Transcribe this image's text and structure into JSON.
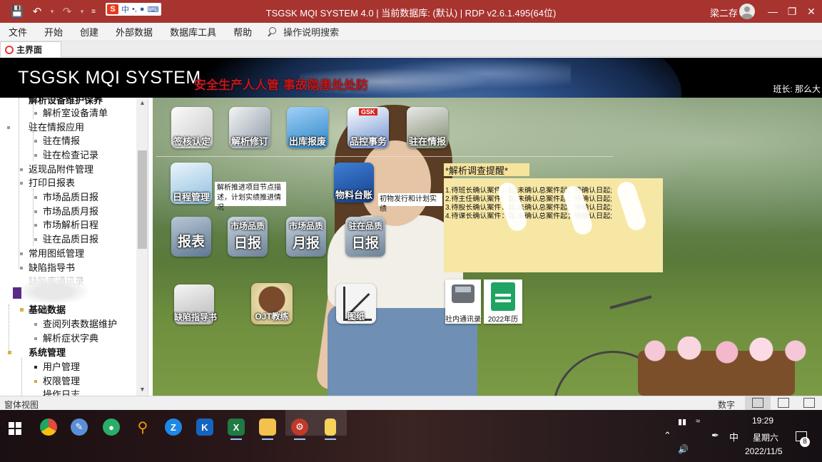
{
  "window": {
    "title": "TSGSK MQI SYSTEM 4.0 | 当前数据库: (默认) | RDP v2.6.1.495(64位)",
    "user": "梁二存",
    "ime": {
      "mode": "中",
      "logo": "S"
    }
  },
  "menu": {
    "items": [
      "文件",
      "开始",
      "创建",
      "外部数据",
      "数据库工具",
      "帮助"
    ],
    "search_label": "操作说明搜索"
  },
  "tabs": [
    {
      "label": "主界面"
    }
  ],
  "banner": {
    "title": "TSGSK MQI SYSTEM",
    "slogan": "安全生产人人管 事故隐患处处防",
    "class_leader": "班长: 那么大"
  },
  "sidebar": {
    "items": [
      {
        "label": "解析设备维护保养",
        "level": 1
      },
      {
        "label": "解析室设备清单",
        "level": 2
      },
      {
        "label": "驻在情报应用",
        "level": 1
      },
      {
        "label": "驻在情报",
        "level": 2
      },
      {
        "label": "驻在检查记录",
        "level": 2
      },
      {
        "label": "返现品附件管理",
        "level": 1
      },
      {
        "label": "打印日报表",
        "level": 1
      },
      {
        "label": "市场品质日报",
        "level": 2
      },
      {
        "label": "市场品质月报",
        "level": 2
      },
      {
        "label": "市场解析日程",
        "level": 2
      },
      {
        "label": "驻在品质日报",
        "level": 2
      },
      {
        "label": "常用图纸管理",
        "level": 1
      },
      {
        "label": "缺陷指导书",
        "level": 1
      },
      {
        "label": "缺陷库通讯录",
        "level": 1
      },
      {
        "label": "基础数据",
        "level": 0
      },
      {
        "label": "查阅列表数据维护",
        "level": 2
      },
      {
        "label": "解析症状字典",
        "level": 2
      },
      {
        "label": "系统管理",
        "level": 0
      },
      {
        "label": "用户管理",
        "level": 2
      },
      {
        "label": "权限管理",
        "level": 2
      },
      {
        "label": "操作日志",
        "level": 2
      }
    ]
  },
  "dashboard": {
    "row1": [
      {
        "label": "签核认定",
        "icon": "signature-icon"
      },
      {
        "label": "解析修订",
        "icon": "analysis-revise-icon"
      },
      {
        "label": "出库报废",
        "icon": "outbound-scrap-icon"
      },
      {
        "label": "品控事务",
        "icon": "quality-control-icon",
        "badge": "GSK"
      },
      {
        "label": "驻在情报",
        "icon": "onsite-info-icon"
      }
    ],
    "schedule": {
      "label": "日程管理",
      "icon": "schedule-icon",
      "desc": "解析推进项目节点描述，计划实绩推进情况"
    },
    "material": {
      "label": "物料台账",
      "icon": "material-ledger-icon",
      "desc": "初物发行和计划实绩"
    },
    "row3": [
      {
        "label": "报表",
        "icon": "report-icon"
      },
      {
        "label": "日报",
        "top": "市场品质",
        "icon": "market-daily-icon"
      },
      {
        "label": "月报",
        "top": "市场品质",
        "icon": "market-monthly-icon"
      },
      {
        "label": "日报",
        "top": "驻在品质",
        "icon": "onsite-daily-icon"
      }
    ],
    "row4": [
      {
        "label": "缺陷指导书",
        "icon": "defect-guide-icon"
      },
      {
        "label": "OJT教练",
        "icon": "ojt-coach-icon"
      },
      {
        "label": "图纸",
        "icon": "drawing-icon"
      },
      {
        "label": "社内通讯录",
        "icon": "phone-directory-icon"
      },
      {
        "label": "2022年历",
        "icon": "calendar-2022-icon"
      }
    ],
    "alert": {
      "title": "*解析调查提醒*",
      "lines": [
        "1.待班长确认案件：起,未确认总案件起；待确认日起;",
        "2.待主任确认案件：起,未确认总案件起；待确认日起;",
        "3.待股长确认案件：起,未确认总案件起；待确认日起;",
        "4.待课长确认案件：起,未确认总案件起；待确认日起;"
      ]
    }
  },
  "statusbar": {
    "left": "窗体视图",
    "num": "数字"
  },
  "taskbar": {
    "time": "19:29",
    "day": "星期六",
    "date": "2022/11/5",
    "ime": "中",
    "notifications": "8",
    "apps": [
      {
        "name": "chrome-icon",
        "color": "#e04a3f"
      },
      {
        "name": "paint-icon",
        "color": "#5a8fd8"
      },
      {
        "name": "wechat-icon",
        "color": "#2aae67"
      },
      {
        "name": "search-app-icon",
        "color": "#f39c12"
      },
      {
        "name": "zhi-icon",
        "color": "#1e88e5"
      },
      {
        "name": "k-app-icon",
        "color": "#1565c0"
      },
      {
        "name": "excel-icon",
        "color": "#1f7a43"
      },
      {
        "name": "folder-icon",
        "color": "#f2c14e"
      },
      {
        "name": "access-app-icon",
        "color": "#c0392b"
      },
      {
        "name": "sticky-notes-icon",
        "color": "#f7d35b"
      }
    ]
  }
}
